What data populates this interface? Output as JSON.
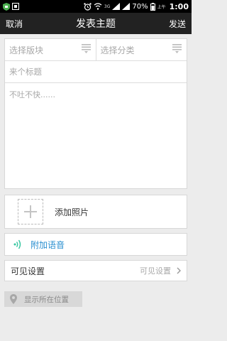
{
  "statusbar": {
    "net_label": "3G",
    "battery": "70%",
    "ampm": "上午",
    "time": "1:00"
  },
  "topbar": {
    "cancel": "取消",
    "title": "发表主题",
    "send": "发送"
  },
  "form": {
    "board_placeholder": "选择版块",
    "category_placeholder": "选择分类",
    "title_placeholder": "来个标题",
    "body_placeholder": "不吐不快......"
  },
  "attachments": {
    "photo_label": "添加照片",
    "voice_label": "附加语音"
  },
  "visibility": {
    "label": "可见设置",
    "value": "可见设置"
  },
  "location": {
    "label": "显示所在位置"
  },
  "colors": {
    "accent": "#2a8fd0",
    "topbar_bg": "#222222",
    "page_bg": "#ececec"
  }
}
